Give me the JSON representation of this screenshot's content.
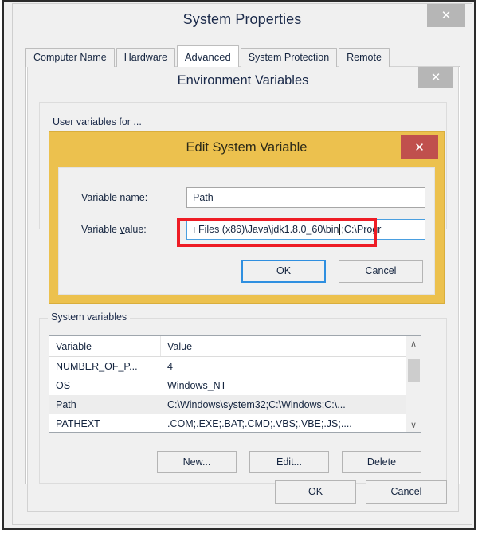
{
  "system_properties": {
    "title": "System Properties",
    "close_icon": "close-icon",
    "close_glyph": "✕",
    "tabs": [
      {
        "label": "Computer Name",
        "active": false
      },
      {
        "label": "Hardware",
        "active": false
      },
      {
        "label": "Advanced",
        "active": true
      },
      {
        "label": "System Protection",
        "active": false
      },
      {
        "label": "Remote",
        "active": false
      }
    ]
  },
  "environment_variables": {
    "title": "Environment Variables",
    "close_glyph": "✕",
    "user_variables_legend": "User variables for ...",
    "system_variables_legend": "System variables",
    "table": {
      "headers": [
        "Variable",
        "Value"
      ],
      "rows": [
        {
          "variable": "NUMBER_OF_P...",
          "value": "4",
          "selected": false
        },
        {
          "variable": "OS",
          "value": "Windows_NT",
          "selected": false
        },
        {
          "variable": "Path",
          "value": "C:\\Windows\\system32;C:\\Windows;C:\\...",
          "selected": true
        },
        {
          "variable": "PATHEXT",
          "value": ".COM;.EXE;.BAT;.CMD;.VBS;.VBE;.JS;....",
          "selected": false
        }
      ]
    },
    "scrollbar": {
      "up_glyph": "∧",
      "down_glyph": "∨"
    },
    "crud_buttons": {
      "new": "New...",
      "edit": "Edit...",
      "delete": "Delete"
    },
    "footer_buttons": {
      "ok": "OK",
      "cancel": "Cancel"
    }
  },
  "edit_system_variable": {
    "title": "Edit System Variable",
    "close_glyph": "✕",
    "titlebar_color": "#ecc14e",
    "close_color": "#c0504d",
    "fields": {
      "name_label_pre": "Variable ",
      "name_label_accel": "n",
      "name_label_post": "ame:",
      "name_value": "Path",
      "value_label_pre": "Variable ",
      "value_label_accel": "v",
      "value_label_post": "alue:",
      "value_value_before_caret": "ı Files (x86)\\Java\\jdk1.8.0_60\\bin",
      "value_value_after_caret": ";C:\\Progr"
    },
    "footer_buttons": {
      "ok": "OK",
      "cancel": "Cancel"
    },
    "annotation": {
      "type": "red-highlight-rectangle",
      "color": "#ee1c25"
    }
  }
}
